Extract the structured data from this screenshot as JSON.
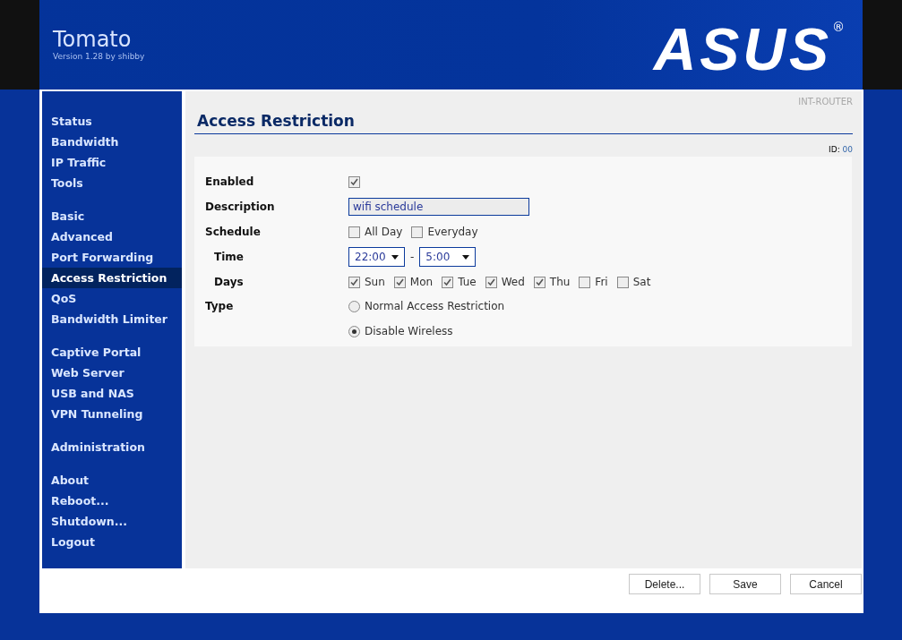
{
  "header": {
    "title": "Tomato",
    "version": "Version 1.28 by shibby",
    "logo": "ASUS",
    "logo_mark": "®"
  },
  "sidebar": {
    "groups": [
      {
        "items": [
          {
            "label": "Status",
            "selected": false
          },
          {
            "label": "Bandwidth",
            "selected": false
          },
          {
            "label": "IP Traffic",
            "selected": false
          },
          {
            "label": "Tools",
            "selected": false
          }
        ]
      },
      {
        "items": [
          {
            "label": "Basic",
            "selected": false
          },
          {
            "label": "Advanced",
            "selected": false
          },
          {
            "label": "Port Forwarding",
            "selected": false
          },
          {
            "label": "Access Restriction",
            "selected": true
          },
          {
            "label": "QoS",
            "selected": false
          },
          {
            "label": "Bandwidth Limiter",
            "selected": false
          }
        ]
      },
      {
        "items": [
          {
            "label": "Captive Portal",
            "selected": false
          },
          {
            "label": "Web Server",
            "selected": false
          },
          {
            "label": "USB and NAS",
            "selected": false
          },
          {
            "label": "VPN Tunneling",
            "selected": false
          }
        ]
      },
      {
        "items": [
          {
            "label": "Administration",
            "selected": false
          }
        ]
      },
      {
        "items": [
          {
            "label": "About",
            "selected": false
          },
          {
            "label": "Reboot...",
            "selected": false
          },
          {
            "label": "Shutdown...",
            "selected": false
          },
          {
            "label": "Logout",
            "selected": false
          }
        ]
      }
    ]
  },
  "page": {
    "router_name": "INT-ROUTER",
    "title": "Access Restriction",
    "id_label": "ID:",
    "id_value": "00"
  },
  "form": {
    "rows": [
      {
        "kind": "checkbox",
        "label": "Enabled",
        "checked": true
      },
      {
        "kind": "text",
        "label": "Description",
        "value": "wifi schedule"
      },
      {
        "kind": "checks",
        "label": "Schedule",
        "options": [
          {
            "label": "All Day",
            "checked": false
          },
          {
            "label": "Everyday",
            "checked": false
          }
        ]
      },
      {
        "kind": "time",
        "label": "Time",
        "start": "22:00",
        "separator": "-",
        "end": "5:00"
      },
      {
        "kind": "checks",
        "label": "Days",
        "options": [
          {
            "label": "Sun",
            "checked": true
          },
          {
            "label": "Mon",
            "checked": true
          },
          {
            "label": "Tue",
            "checked": true
          },
          {
            "label": "Wed",
            "checked": true
          },
          {
            "label": "Thu",
            "checked": true
          },
          {
            "label": "Fri",
            "checked": false
          },
          {
            "label": "Sat",
            "checked": false
          }
        ]
      },
      {
        "kind": "radio",
        "label": "Type",
        "options": [
          {
            "label": "Normal Access Restriction",
            "selected": false
          },
          {
            "label": "Disable Wireless",
            "selected": true
          }
        ]
      }
    ]
  },
  "buttons": [
    "Delete...",
    "Save",
    "Cancel"
  ]
}
